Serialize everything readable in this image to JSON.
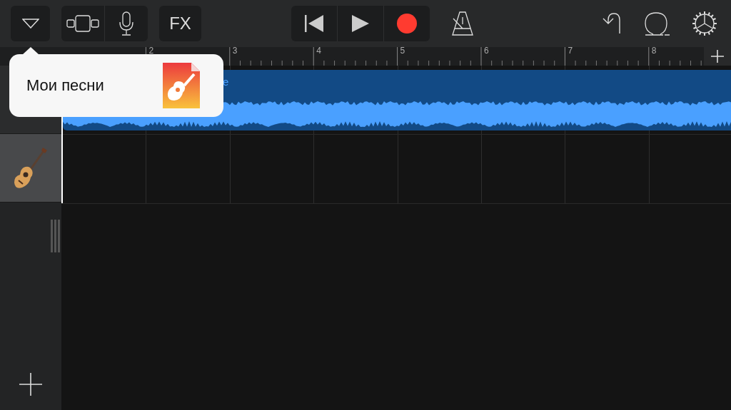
{
  "toolbar": {
    "fx_label": "FX"
  },
  "popover": {
    "label": "Мои песни"
  },
  "ruler": {
    "bars": [
      "2",
      "3",
      "4",
      "5",
      "6",
      "7",
      "8"
    ]
  },
  "tracks": [
    {
      "kind": "audio",
      "selected": false,
      "region_label": "e"
    },
    {
      "kind": "instrument",
      "selected": true
    }
  ]
}
